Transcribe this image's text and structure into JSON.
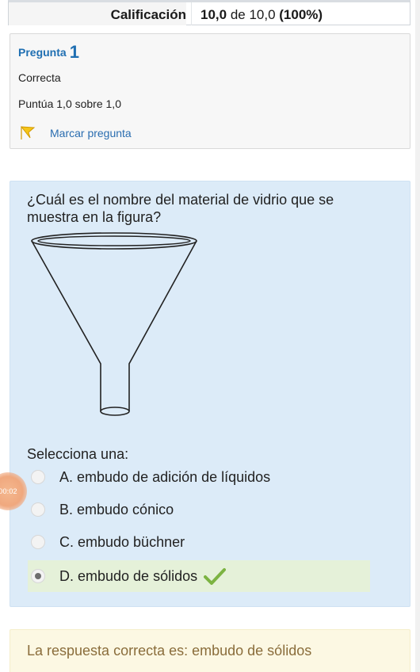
{
  "grade": {
    "label": "Calificación",
    "value_bold": "10,0",
    "value_mid": " de 10,0 ",
    "value_pct": "(100%)"
  },
  "question_info": {
    "title": "Pregunta",
    "number": "1",
    "state": "Correcta",
    "grade_text": "Puntúa 1,0 sobre 1,0",
    "flag_label": "Marcar pregunta",
    "flag_icon": "flag-icon"
  },
  "question": {
    "text": "¿Cuál es el nombre del material de vidrio que se muestra en la figura?",
    "image_icon": "funnel-image",
    "prompt": "Selecciona una:",
    "options": [
      {
        "label": "A. embudo de adición de líquidos",
        "selected": false
      },
      {
        "label": "B. embudo cónico",
        "selected": false
      },
      {
        "label": "C. embudo büchner",
        "selected": false
      },
      {
        "label": "D. embudo de sólidos",
        "selected": true,
        "correct": true
      }
    ],
    "correct_icon": "checkmark-icon"
  },
  "timer": {
    "text": "00:02"
  },
  "feedback": {
    "text": "La respuesta correcta es: embudo de sólidos"
  },
  "colors": {
    "question_bg": "#dcebf8",
    "info_bg": "#f7f7f7",
    "feedback_bg": "#fcf8e3",
    "feedback_text": "#8a6d3b",
    "correct_bg": "#e5f1d9",
    "link_blue": "#1f6fb2",
    "check_green": "#7cb342"
  }
}
